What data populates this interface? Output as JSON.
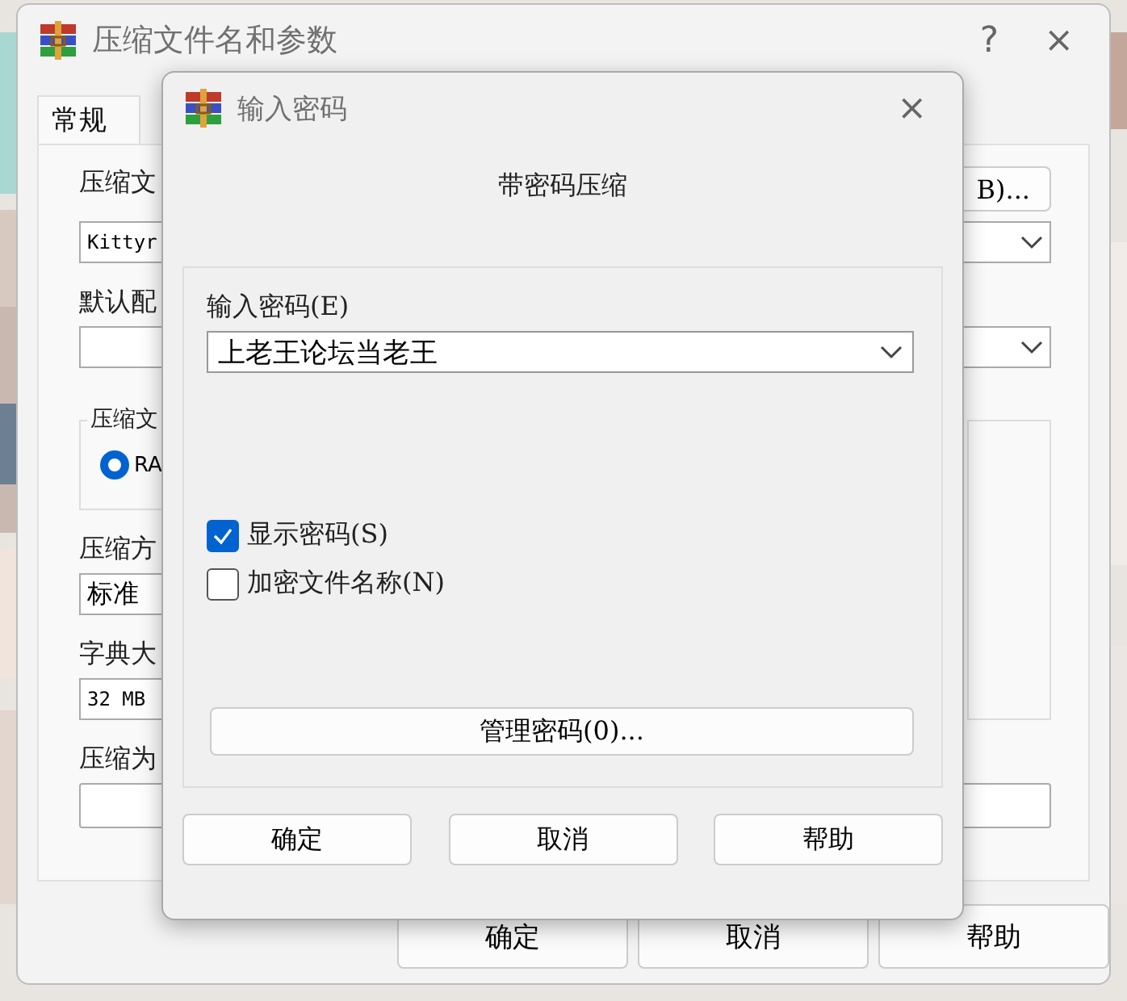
{
  "back_window": {
    "title": "压缩文件名和参数",
    "help_button": "?",
    "close_button": "×",
    "tabs": [
      {
        "label": "常规",
        "selected": true
      }
    ],
    "archive_name": {
      "label": "压缩文",
      "value": "Kittyr",
      "browse_button": "B)..."
    },
    "profile": {
      "label": "默认配"
    },
    "format_group": {
      "label": "压缩文",
      "options": [
        {
          "label": "RA",
          "selected": true
        }
      ]
    },
    "method": {
      "label": "压缩方",
      "value": "标准"
    },
    "dictionary": {
      "label": "字典大",
      "value": "32 MB"
    },
    "split": {
      "label": "压缩为"
    },
    "buttons": [
      "确定",
      "取消",
      "帮助"
    ]
  },
  "password_dialog": {
    "title": "输入密码",
    "close_button": "×",
    "heading": "带密码压缩",
    "password": {
      "label": "输入密码(E)",
      "value": "上老王论坛当老王"
    },
    "options": [
      {
        "label": "显示密码(S)",
        "checked": true
      },
      {
        "label": "加密文件名称(N)",
        "checked": false
      }
    ],
    "manage_button": "管理密码(0)...",
    "buttons": [
      "确定",
      "取消",
      "帮助"
    ]
  }
}
